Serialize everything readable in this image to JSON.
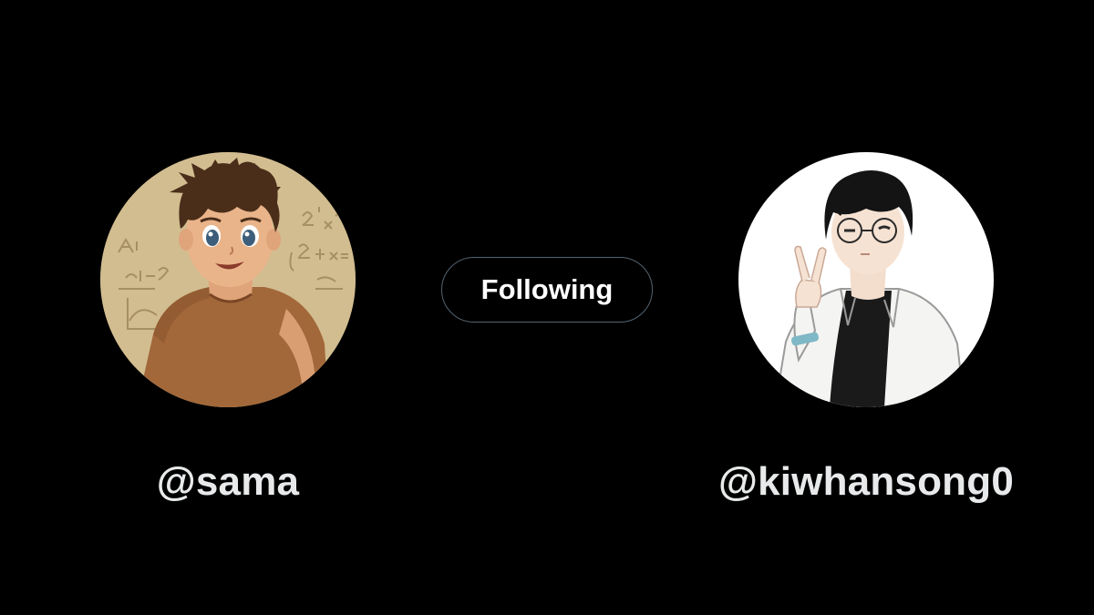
{
  "left_profile": {
    "handle": "@sama",
    "avatar_icon": "anime-boy-avatar-icon"
  },
  "right_profile": {
    "handle": "@kiwhansong0",
    "avatar_icon": "illustrated-man-peace-sign-avatar-icon"
  },
  "follow_button": {
    "label": "Following"
  },
  "colors": {
    "background": "#000000",
    "handle_text": "#e7e9ea",
    "button_border": "#536471",
    "button_text": "#ffffff"
  }
}
